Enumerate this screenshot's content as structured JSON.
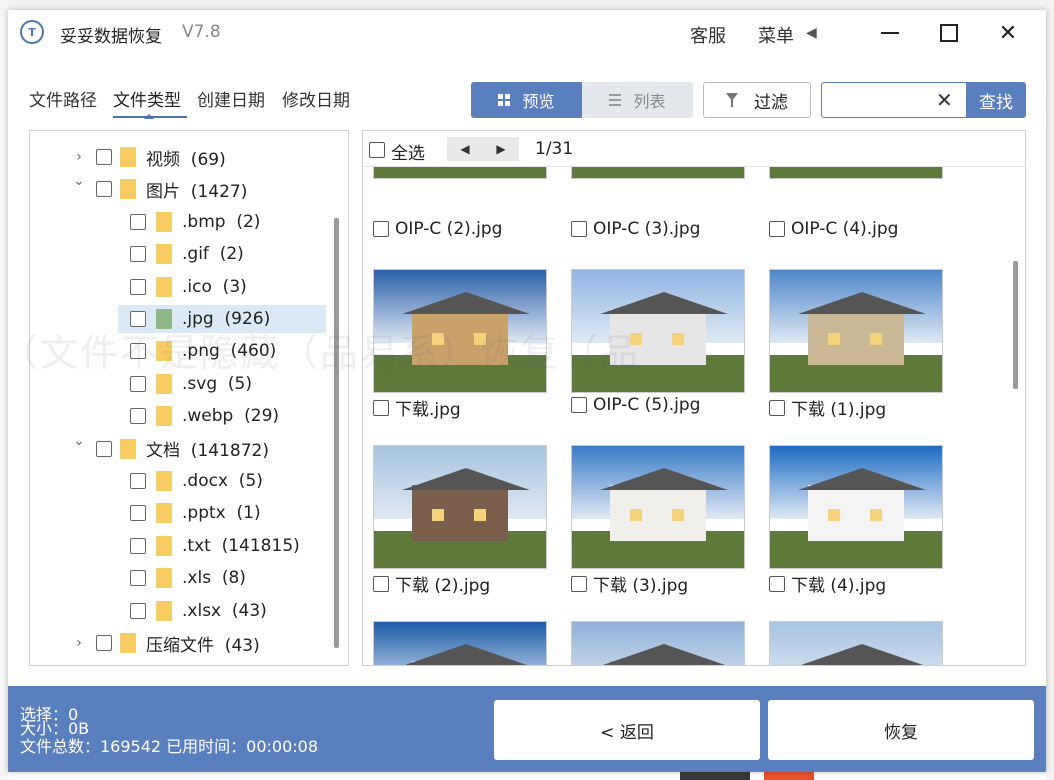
{
  "app": {
    "title": "妥妥数据恢复",
    "version": "V7.8",
    "kefu": "客服",
    "menu": "菜单"
  },
  "tabs": [
    "文件路径",
    "文件类型",
    "创建日期",
    "修改日期"
  ],
  "active_tab": "文件类型",
  "view": {
    "preview_label": "预览",
    "list_label": "列表",
    "filter_label": "过滤"
  },
  "search": {
    "value": "",
    "button_label": "查找"
  },
  "tree": [
    {
      "name": "视频",
      "count": "(69)",
      "expanded": false,
      "level": 0
    },
    {
      "name": "图片",
      "count": "(1427)",
      "expanded": true,
      "level": 0
    },
    {
      "name": ".bmp",
      "count": "(2)",
      "level": 1
    },
    {
      "name": ".gif",
      "count": "(2)",
      "level": 1
    },
    {
      "name": ".ico",
      "count": "(3)",
      "level": 1
    },
    {
      "name": ".jpg",
      "count": "(926)",
      "level": 1,
      "selected": true
    },
    {
      "name": ".png",
      "count": "(460)",
      "level": 1
    },
    {
      "name": ".svg",
      "count": "(5)",
      "level": 1
    },
    {
      "name": ".webp",
      "count": "(29)",
      "level": 1
    },
    {
      "name": "文档",
      "count": "(141872)",
      "expanded": true,
      "level": 0
    },
    {
      "name": ".docx",
      "count": "(5)",
      "level": 1
    },
    {
      "name": ".pptx",
      "count": "(1)",
      "level": 1
    },
    {
      "name": ".txt",
      "count": "(141815)",
      "level": 1
    },
    {
      "name": ".xls",
      "count": "(8)",
      "level": 1
    },
    {
      "name": ".xlsx",
      "count": "(43)",
      "level": 1
    },
    {
      "name": "压缩文件",
      "count": "(43)",
      "expanded": false,
      "level": 0
    }
  ],
  "content": {
    "select_all": "全选",
    "page": "1/31",
    "files": [
      {
        "name": "OIP-C (2).jpg"
      },
      {
        "name": "OIP-C (3).jpg"
      },
      {
        "name": "OIP-C (4).jpg"
      },
      {
        "name": "下载.jpg"
      },
      {
        "name": "OIP-C (5).jpg"
      },
      {
        "name": "下载 (1).jpg"
      },
      {
        "name": "下载 (2).jpg"
      },
      {
        "name": "下载 (3).jpg"
      },
      {
        "name": "下载 (4).jpg"
      }
    ]
  },
  "watermark": "（文件不是隐藏（品易系）恢复（品",
  "footer": {
    "selected": "选择：0",
    "size": "大小：0B",
    "total": "文件总数：169542    已用时间：00:00:08",
    "back_label": "< 返回",
    "recover_label": "恢复"
  },
  "colors": {
    "accent": "#5a7fbf",
    "folder": "#f7cd63",
    "selected_row": "#dbe8f6"
  }
}
